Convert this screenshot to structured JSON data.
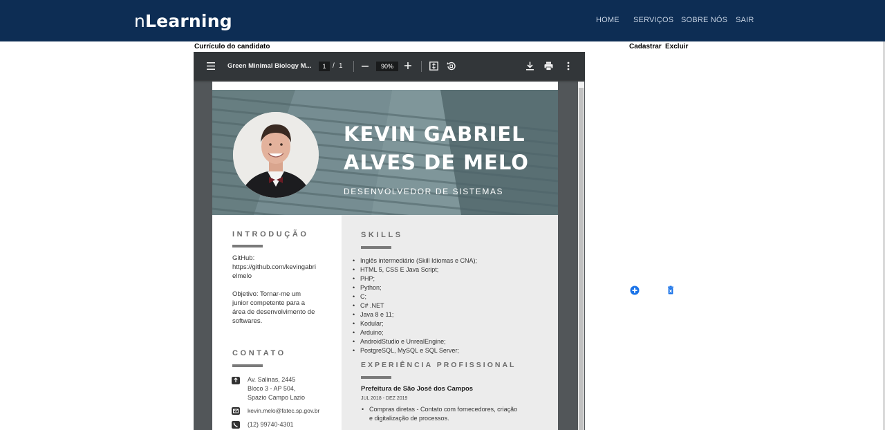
{
  "nav": {
    "brand_prefix": "n",
    "brand_main": "Learning",
    "links": [
      "HOME",
      "SERVIÇOS",
      "SOBRE NÓS",
      "SAIR"
    ]
  },
  "main": {
    "title": "Currículo do candidato",
    "actions": {
      "register": "Cadastrar",
      "delete": "Excluir"
    }
  },
  "pdf_viewer": {
    "file_title": "Green Minimal Biology M...",
    "current_page": "1",
    "page_separator": "/",
    "total_pages": "1",
    "zoom": "90%"
  },
  "resume": {
    "name_line1": "KEVIN GABRIEL",
    "name_line2": "ALVES DE MELO",
    "role": "DESENVOLVEDOR DE SISTEMAS",
    "intro_title": "INTRODUÇÃO",
    "intro_github_label": "GitHub:",
    "intro_github_url_1": "https://github.com/kevingabri",
    "intro_github_url_2": "elmelo",
    "intro_objective": [
      "Objetivo: Tornar-me um",
      "junior competente para a",
      "área de desenvolvimento de",
      "softwares."
    ],
    "contact_title": "CONTATO",
    "address": [
      "Av. Salinas, 2445",
      "Bloco 3 - AP 504,",
      "Spazio Campo Lazio"
    ],
    "email": "kevin.melo@fatec.sp.gov.br",
    "phone": "(12) 99740-4301",
    "skills_title": "SKILLS",
    "skills": [
      "Inglês intermediário (Skill Idiomas e CNA);",
      "HTML 5, CSS E Java Script;",
      "PHP;",
      "Python;",
      "C;",
      "C# .NET",
      "Java 8 e 11;",
      "Kodular;",
      "Arduino;",
      "AndroidStudio e UnrealEngine;",
      "PostgreSQL, MySQL e SQL Server;"
    ],
    "experience_title": "EXPERIÊNCIA PROFISSIONAL",
    "job_company": "Prefeitura de São José dos Campos",
    "job_period": "JUL 2018 - DEZ 2019",
    "job_desc": [
      "Compras diretas - Contato com fornecedores, criação",
      "e digitalização de processos."
    ]
  },
  "colors": {
    "navbar": "#0d2d54",
    "hero": "#6e858a",
    "pdf_toolbar": "#323639",
    "pdf_background": "#525659",
    "action_icon_blue": "#1a73e8"
  },
  "icons": {
    "add": "plus-circle-icon",
    "delete": "trash-icon"
  }
}
